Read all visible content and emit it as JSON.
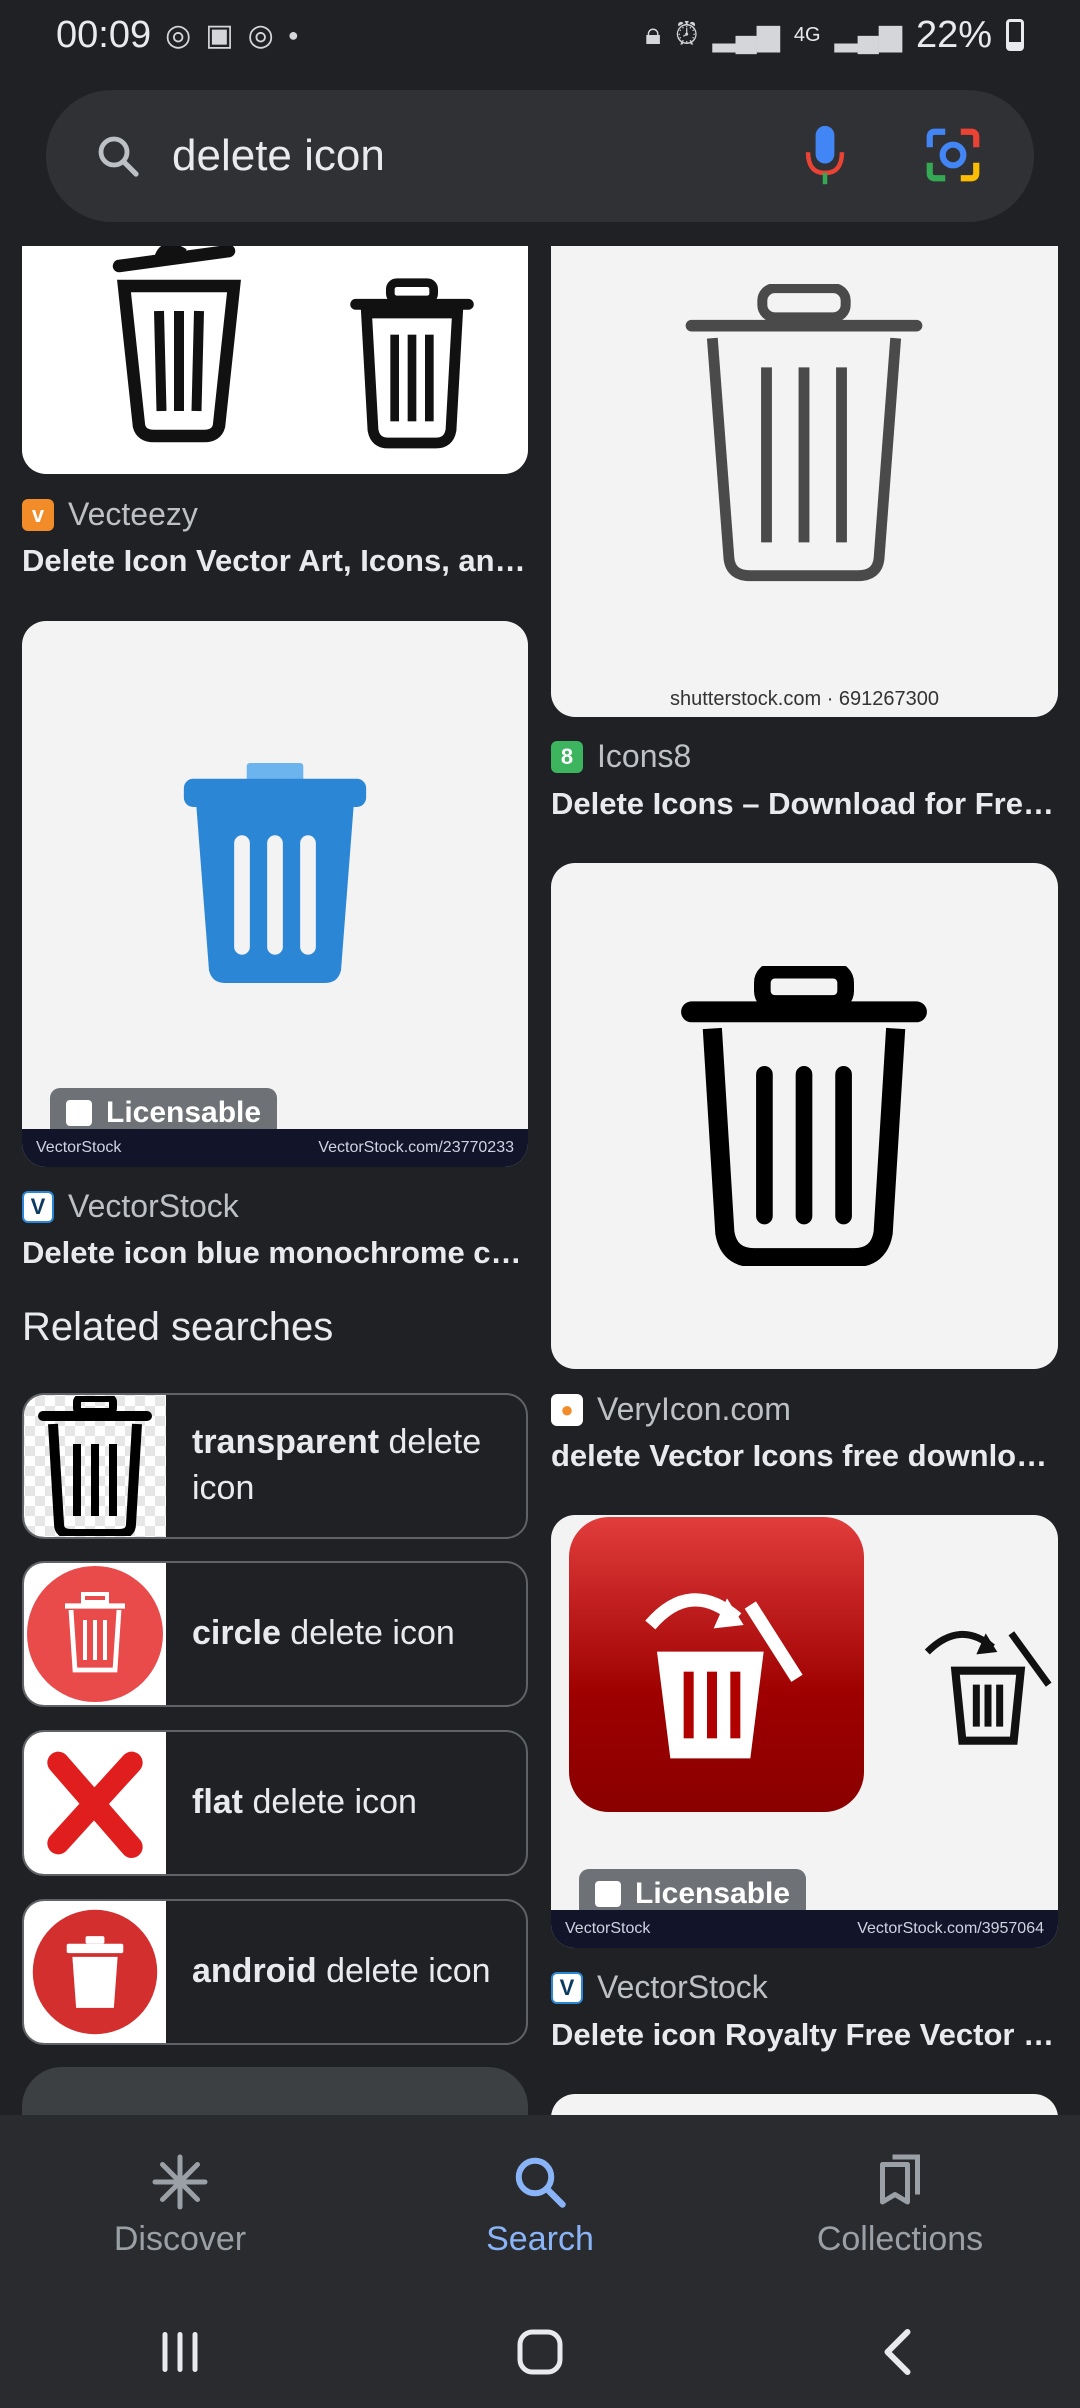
{
  "status_bar": {
    "time": "00:09",
    "battery": "22%",
    "network": "4G"
  },
  "search": {
    "query": "delete icon"
  },
  "results": [
    {
      "source": "Vecteezy",
      "title": "Delete Icon Vector Art, Icons, an…"
    },
    {
      "source": "Icons8",
      "title": "Delete Icons – Download for Fre…",
      "watermark": "shutterstock.com · 691267300"
    },
    {
      "source": "VectorStock",
      "title": "Delete icon blue monochrome c…",
      "badge": "Licensable",
      "watermark_left": "VectorStock",
      "watermark_right": "VectorStock.com/23770233"
    },
    {
      "source": "VeryIcon.com",
      "title": "delete Vector Icons free downlo…"
    },
    {
      "source": "VectorStock",
      "title": "Delete icon Royalty Free Vector …",
      "badge": "Licensable",
      "watermark_left": "VectorStock",
      "watermark_right": "VectorStock.com/3957064"
    }
  ],
  "related": {
    "heading": "Related searches",
    "items": [
      {
        "bold": "transparent",
        "rest": " delete icon"
      },
      {
        "bold": "circle",
        "rest": " delete icon"
      },
      {
        "bold": "flat",
        "rest": " delete icon"
      },
      {
        "bold": "android",
        "rest": " delete icon"
      }
    ]
  },
  "bottom_nav": {
    "items": [
      {
        "label": "Discover",
        "icon": "asterisk-icon"
      },
      {
        "label": "Search",
        "icon": "search-icon"
      },
      {
        "label": "Collections",
        "icon": "collections-icon"
      }
    ],
    "active": "Search"
  },
  "colors": {
    "background": "#202124",
    "accent": "#8ab4f8",
    "searchbar": "#303134"
  }
}
